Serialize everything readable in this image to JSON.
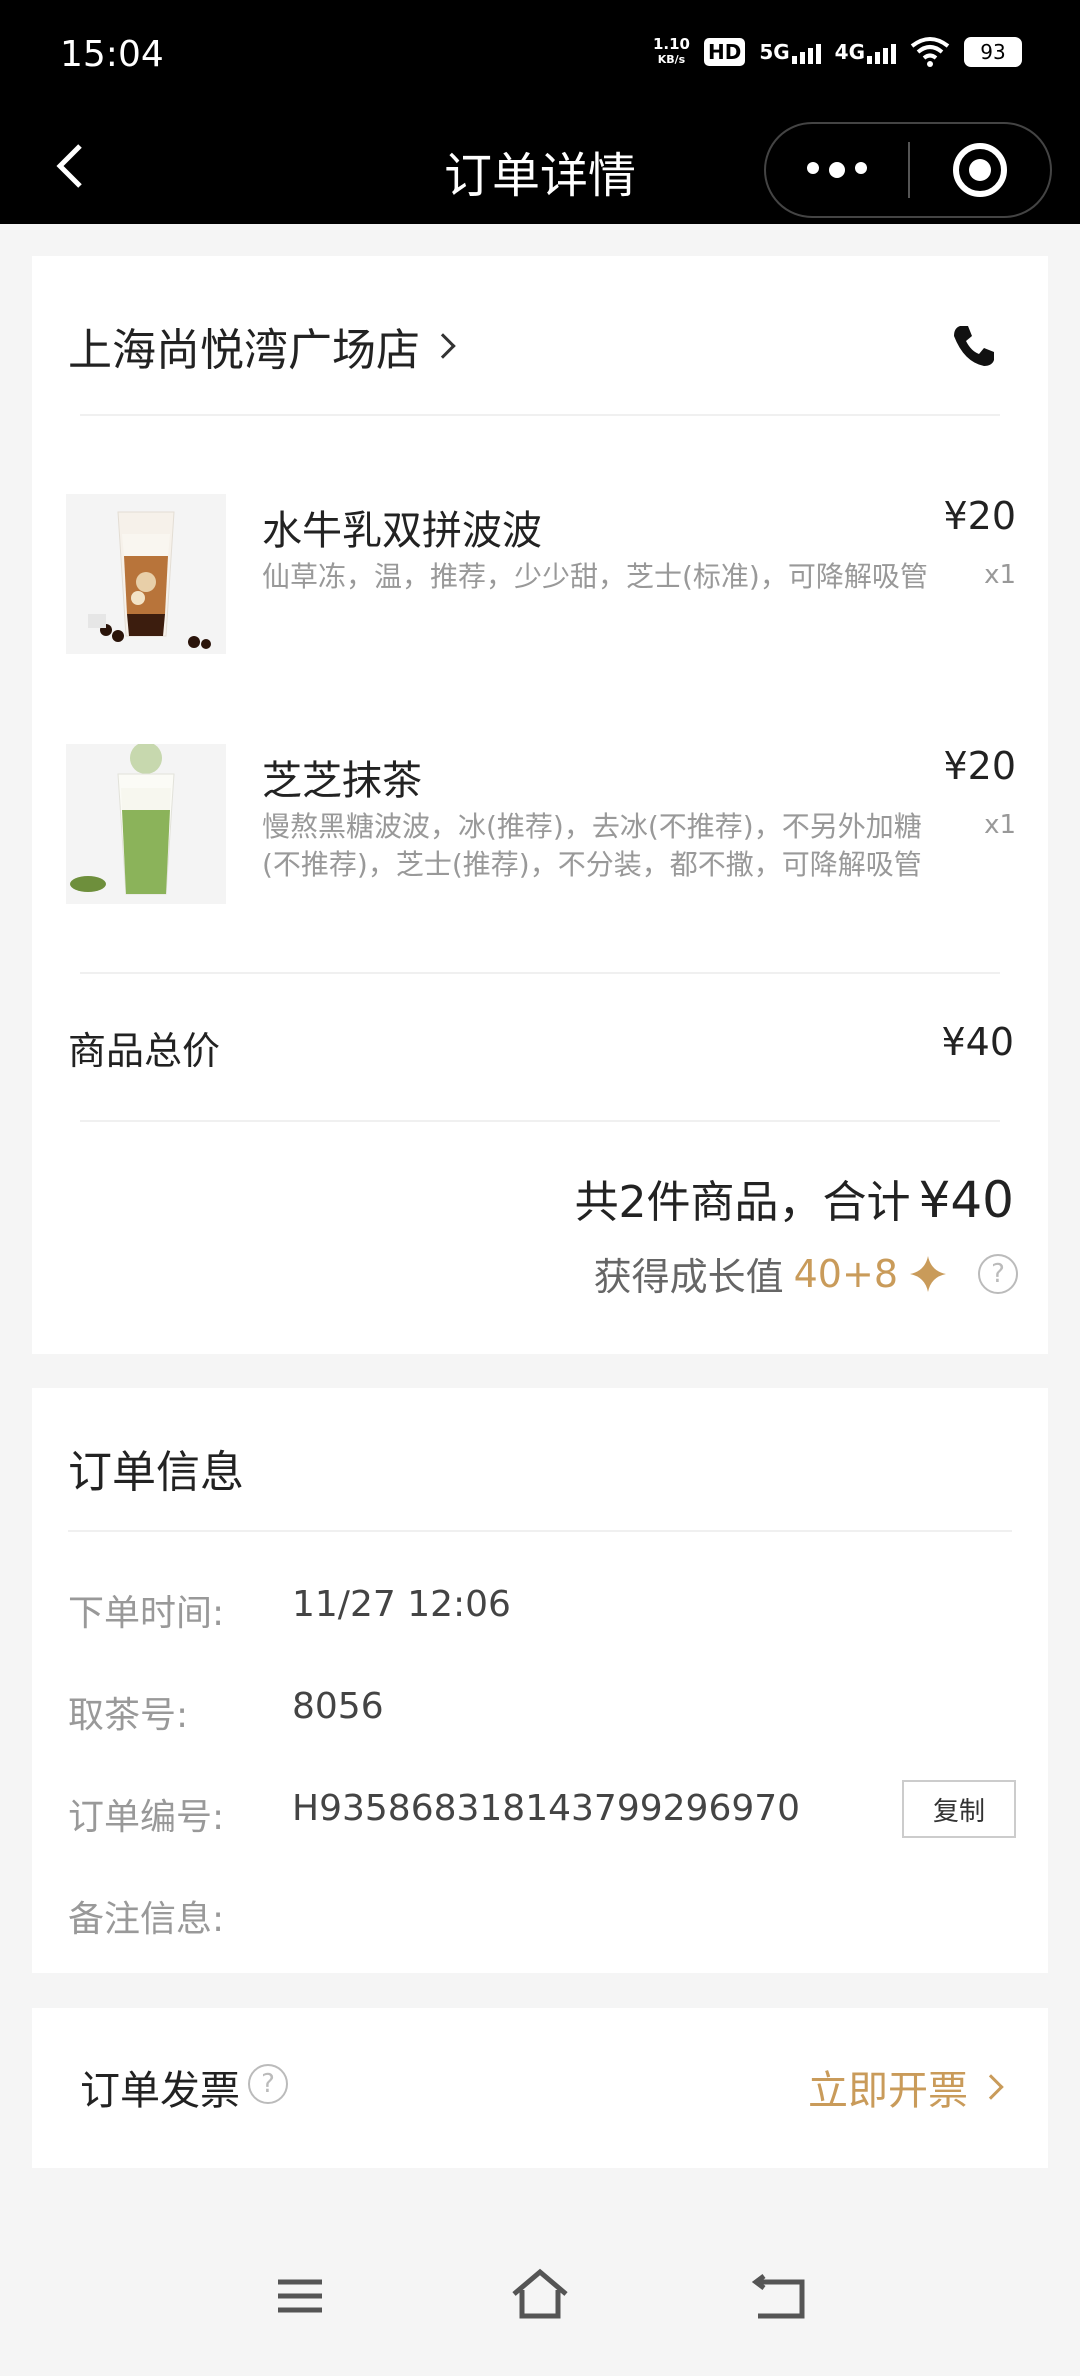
{
  "status_bar": {
    "time": "15:04",
    "net_speed_value": "1.10",
    "net_speed_unit": "KB/s",
    "hd": "HD",
    "sim1": "5G",
    "sim2": "4G",
    "battery": "93"
  },
  "navbar": {
    "title": "订单详情"
  },
  "order": {
    "store_name": "上海尚悦湾广场店",
    "items": [
      {
        "name": "水牛乳双拼波波",
        "desc": "仙草冻，温，推荐，少少甜，芝士(标准)，可降解吸管",
        "price": "¥20",
        "qty": "x1"
      },
      {
        "name": "芝芝抹茶",
        "desc": "慢熬黑糖波波，冰(推荐)，去冰(不推荐)，不另外加糖(不推荐)，芝士(推荐)，不分装，都不撒，可降解吸管",
        "price": "¥20",
        "qty": "x1"
      }
    ],
    "subtotal_label": "商品总价",
    "subtotal_value": "¥40",
    "summary_text": "共2件商品，合计",
    "summary_amount": "¥40",
    "growth_label": "获得成长值",
    "growth_points": "40+8",
    "help_glyph": "?"
  },
  "order_info": {
    "title": "订单信息",
    "rows": [
      {
        "label": "下单时间:",
        "value": "11/27 12:06"
      },
      {
        "label": "取茶号:",
        "value": "8056"
      },
      {
        "label": "订单编号:",
        "value": "H9358683181437992969​70"
      },
      {
        "label": "备注信息:",
        "value": ""
      }
    ],
    "copy_label": "复制"
  },
  "invoice": {
    "label": "订单发票",
    "action": "立即开票"
  },
  "colors": {
    "accent": "#c99b5a",
    "header_bg": "#000000",
    "page_bg": "#f5f5f5"
  },
  "icons": [
    "back-icon",
    "more-icon",
    "target-icon",
    "chevron-right-icon",
    "phone-icon",
    "star-icon",
    "help-icon",
    "menu-icon",
    "home-icon",
    "return-icon"
  ]
}
